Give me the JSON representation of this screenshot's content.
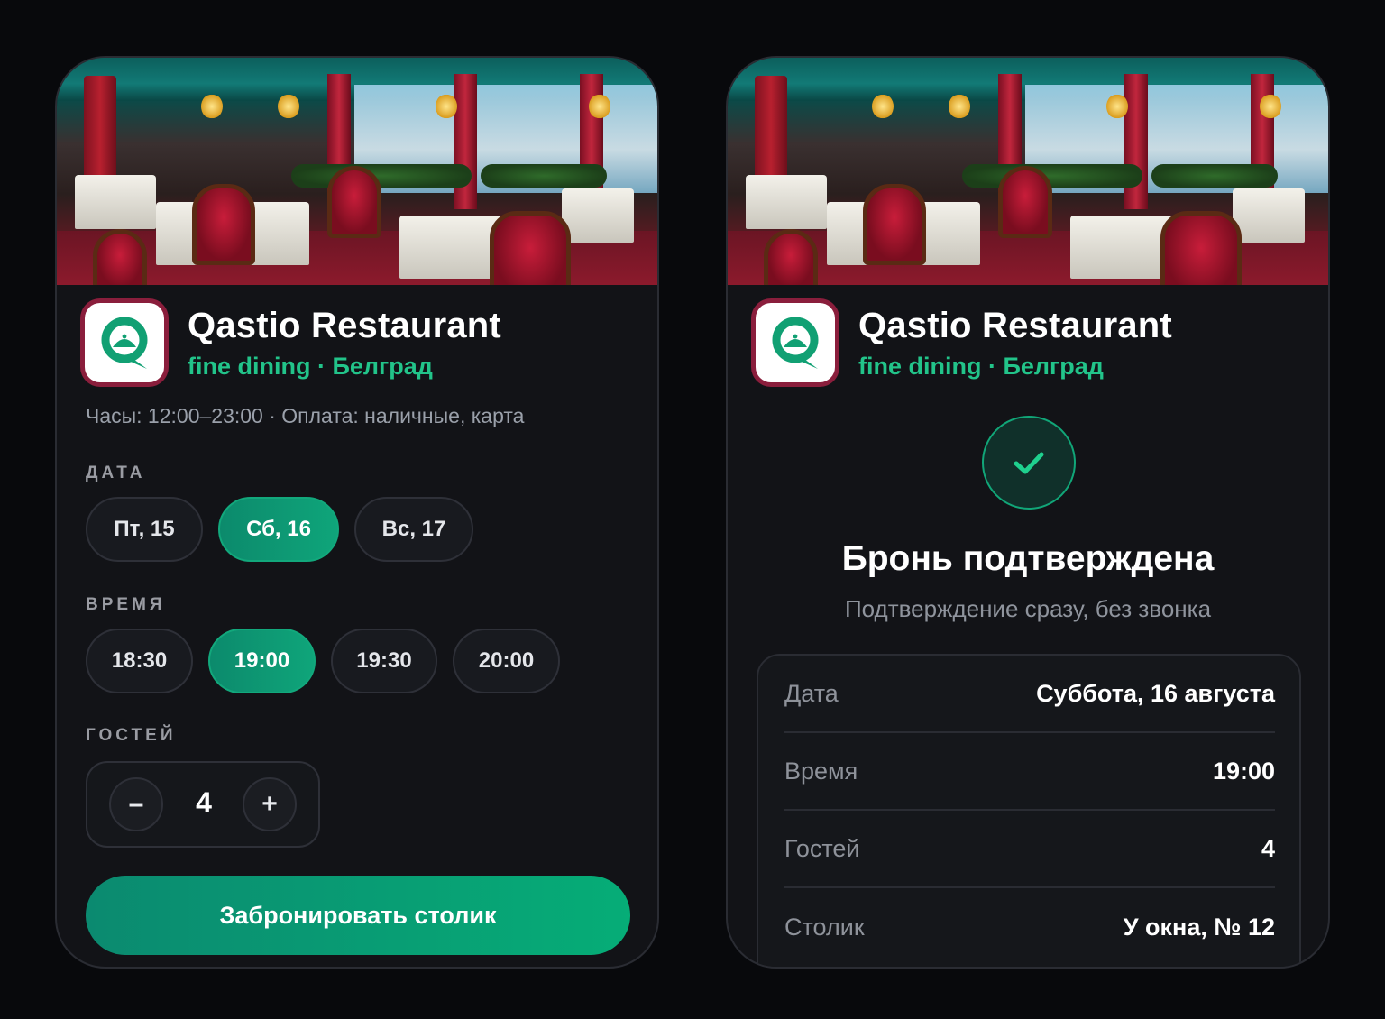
{
  "restaurant": {
    "name": "Qastio Restaurant",
    "subtitle": "fine dining · Белград",
    "info": "Часы: 12:00–23:00 · Оплата: наличные, карта"
  },
  "booking": {
    "date_label": "ДАТА",
    "dates": [
      {
        "label": "Пт, 15",
        "selected": false
      },
      {
        "label": "Сб, 16",
        "selected": true
      },
      {
        "label": "Вс, 17",
        "selected": false
      }
    ],
    "time_label": "ВРЕМЯ",
    "times": [
      {
        "label": "18:30",
        "selected": false
      },
      {
        "label": "19:00",
        "selected": true
      },
      {
        "label": "19:30",
        "selected": false
      },
      {
        "label": "20:00",
        "selected": false
      }
    ],
    "guests_label": "ГОСТЕЙ",
    "guests": {
      "minus": "–",
      "value": "4",
      "plus": "+"
    },
    "cta": "Забронировать столик"
  },
  "confirmation": {
    "title": "Бронь подтверждена",
    "subtitle": "Подтверждение сразу, без звонка",
    "rows": [
      {
        "label": "Дата",
        "value": "Суббота, 16 августа"
      },
      {
        "label": "Время",
        "value": "19:00"
      },
      {
        "label": "Гостей",
        "value": "4"
      },
      {
        "label": "Столик",
        "value": "У окна, № 12"
      }
    ]
  },
  "colors": {
    "accent": "#0fa57a",
    "accent_text": "#22c48a",
    "logo_border": "#8a1e3c",
    "background": "#08090c",
    "card": "#121317"
  },
  "icons": {
    "check": "check-icon",
    "logo": "qastio-logo-icon"
  }
}
